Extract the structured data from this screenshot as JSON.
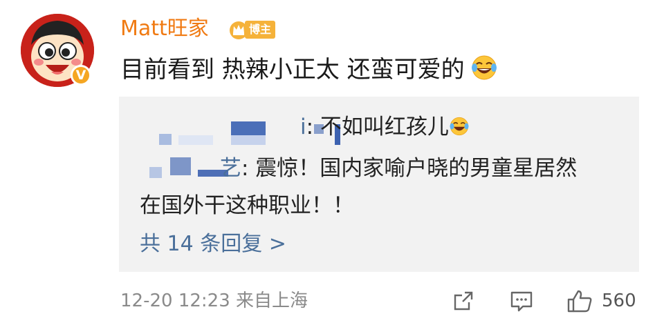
{
  "author": {
    "name": "Matt旺家",
    "badge_label": "博主",
    "verified_mark": "V",
    "avatar_icon": "wangzai-avatar-icon",
    "name_color": "#f07a12"
  },
  "post": {
    "text": "目前看到 热辣小正太 还蛮可爱的",
    "emoji_icon": "laughing-tears-emoji"
  },
  "replies": {
    "items": [
      {
        "author_visible": "i",
        "text": ": 不如叫红孩儿",
        "emoji_icon": "laughing-tears-emoji"
      },
      {
        "author_visible": "艺",
        "text": ": 震惊！国内家喻户晓的男童星居然",
        "text_cont": "在国外干这种职业！！"
      }
    ],
    "more_label": "共 14 条回复 >",
    "more_color": "#4a6f9a"
  },
  "footer": {
    "timestamp": "12-20 12:23 来自上海",
    "share_icon": "share-icon",
    "comment_icon": "comment-icon",
    "like_icon": "thumbs-up-icon",
    "like_count": "560"
  }
}
